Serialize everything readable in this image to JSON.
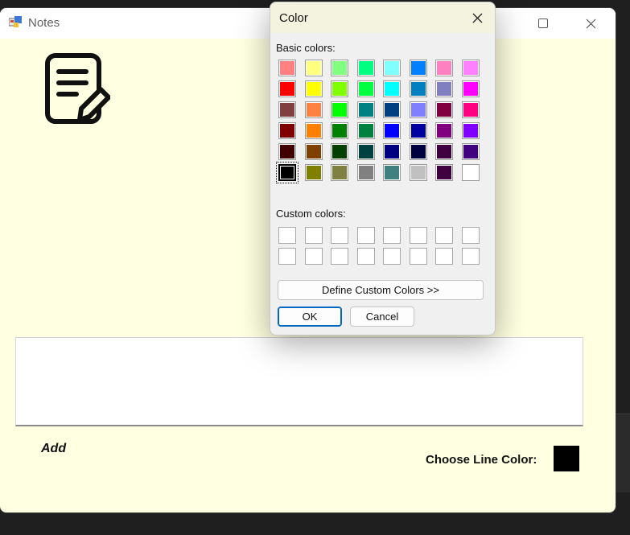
{
  "main_window": {
    "title": "Notes",
    "add_label": "Add",
    "line_color_label": "Choose Line Color:",
    "line_color": "#000000"
  },
  "color_dialog": {
    "title": "Color",
    "basic_colors_label": "Basic colors:",
    "custom_colors_label": "Custom colors:",
    "define_custom_label": "Define Custom Colors >>",
    "ok_label": "OK",
    "cancel_label": "Cancel",
    "basic_colors": [
      "#ff8080",
      "#ffff80",
      "#80ff80",
      "#00ff80",
      "#80ffff",
      "#0080ff",
      "#ff80c0",
      "#ff80ff",
      "#ff0000",
      "#ffff00",
      "#80ff00",
      "#00ff40",
      "#00ffff",
      "#0080c0",
      "#8080c0",
      "#ff00ff",
      "#804040",
      "#ff8040",
      "#00ff00",
      "#008080",
      "#004080",
      "#8080ff",
      "#800040",
      "#ff0080",
      "#800000",
      "#ff8000",
      "#008000",
      "#008040",
      "#0000ff",
      "#0000a0",
      "#800080",
      "#8000ff",
      "#400000",
      "#804000",
      "#004000",
      "#004040",
      "#000080",
      "#000040",
      "#400040",
      "#400080",
      "#000000",
      "#808000",
      "#808040",
      "#808080",
      "#408080",
      "#c0c0c0",
      "#400040",
      "#ffffff"
    ],
    "selected_index": 40,
    "custom_colors": [
      "#ffffff",
      "#ffffff",
      "#ffffff",
      "#ffffff",
      "#ffffff",
      "#ffffff",
      "#ffffff",
      "#ffffff",
      "#ffffff",
      "#ffffff",
      "#ffffff",
      "#ffffff",
      "#ffffff",
      "#ffffff",
      "#ffffff",
      "#ffffff"
    ]
  }
}
